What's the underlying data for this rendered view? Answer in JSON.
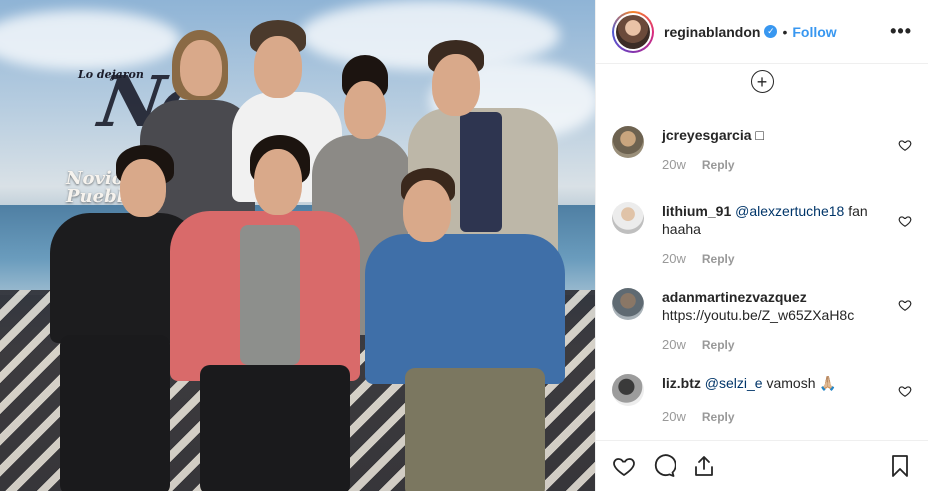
{
  "post": {
    "image_text": {
      "small": "Lo dejaron",
      "big": "No",
      "sub_line1": "Novio",
      "sub_line2": "Pueblo"
    }
  },
  "header": {
    "username": "reginablandon",
    "verified_icon": "verified-badge-icon",
    "separator": "•",
    "follow_label": "Follow",
    "more_label": "•••"
  },
  "load_more_icon": "plus-circle-icon",
  "comments": [
    {
      "user": "jcreyesgarcia",
      "text": " □",
      "mention": "",
      "time": "20w",
      "reply": "Reply"
    },
    {
      "user": "lithium_91",
      "mention": "@alexzertuche18",
      "text": " fan haaha",
      "time": "20w",
      "reply": "Reply"
    },
    {
      "user": "adanmartinezvazquez",
      "mention": "",
      "text": " https://youtu.be/Z_w65ZXaH8c",
      "time": "20w",
      "reply": "Reply"
    },
    {
      "user": "liz.btz",
      "mention": "@selzi_e",
      "text": " vamosh 🙏🏼",
      "time": "20w",
      "reply": "Reply"
    }
  ],
  "actions": {
    "like_icon": "heart-icon",
    "comment_icon": "comment-icon",
    "share_icon": "share-icon",
    "save_icon": "bookmark-icon"
  },
  "colors": {
    "accent": "#3897f0",
    "text": "#262626",
    "muted": "#999999",
    "mention": "#003569"
  }
}
